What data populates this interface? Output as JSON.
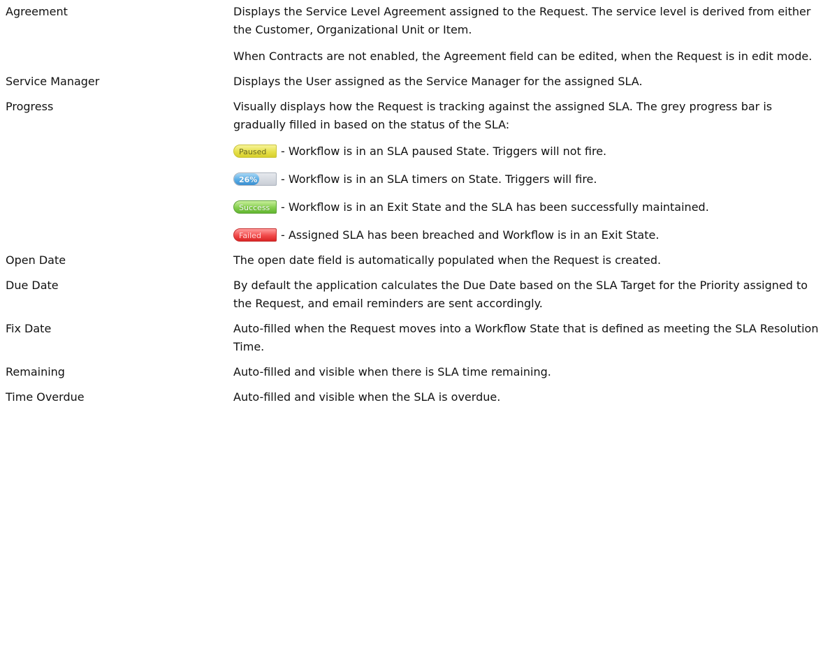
{
  "rows": [
    {
      "term": "Agreement",
      "paragraphs": [
        "Displays the Service Level Agreement assigned to the Request. The service level is derived from either the Customer, Organizational Unit or Item.",
        "When Contracts are not enabled, the Agreement field can be edited, when the Request is in edit mode."
      ]
    },
    {
      "term": "Service Manager",
      "paragraphs": [
        "Displays the User assigned as the Service Manager for the assigned SLA."
      ]
    },
    {
      "term": "Progress",
      "paragraphs": [
        "Visually displays how the Request is tracking against the assigned SLA. The grey progress bar is gradually filled in based on the status of the SLA:"
      ],
      "statuses": [
        {
          "badge_label": "Paused",
          "badge_color": "#e6e04a",
          "text": " - Workflow is in an SLA paused State. Triggers will not fire."
        },
        {
          "badge_label": "26%",
          "badge_color": "#5aaee6",
          "progress": 0.26,
          "text": " - Workflow is in an SLA timers on State. Triggers will fire."
        },
        {
          "badge_label": "Success",
          "badge_color": "#86cf4e",
          "text": " - Workflow is in an Exit State and the SLA has been successfully maintained."
        },
        {
          "badge_label": "Failed",
          "badge_color": "#f14a4a",
          "text": " - Assigned SLA has been breached and Workflow is in an Exit State."
        }
      ]
    },
    {
      "term": "Open Date",
      "paragraphs": [
        "The open date field is automatically populated when the Request is created."
      ]
    },
    {
      "term": "Due Date",
      "paragraphs": [
        "By default the application calculates the Due Date based on the SLA Target for the Priority assigned to the Request, and email reminders are sent accordingly."
      ]
    },
    {
      "term": "Fix Date",
      "paragraphs": [
        "Auto-filled when the Request moves into a Workflow State that is defined as meeting the SLA Resolution Time."
      ]
    },
    {
      "term": "Remaining",
      "paragraphs": [
        "Auto-filled and visible when there is SLA time remaining."
      ]
    },
    {
      "term": "Time Overdue",
      "paragraphs": [
        "Auto-filled and visible when the SLA is overdue."
      ]
    }
  ]
}
